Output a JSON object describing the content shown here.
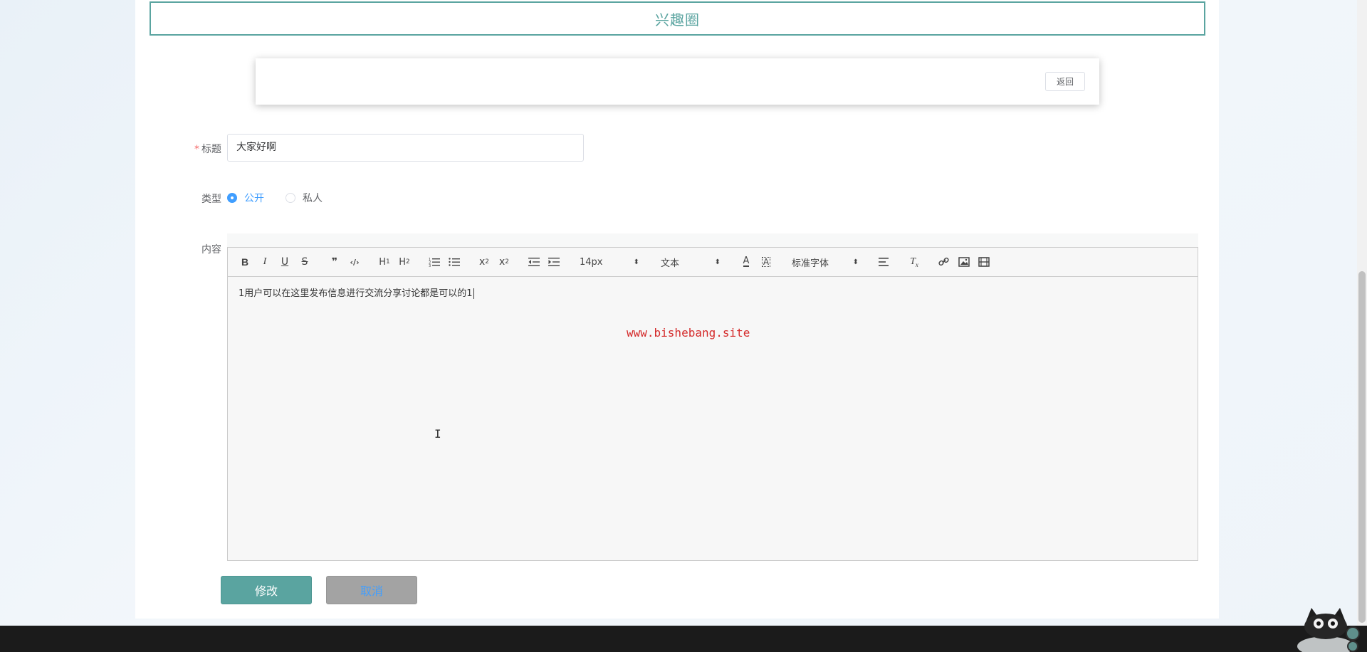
{
  "header": {
    "title": "兴趣圈"
  },
  "toolbar_card": {
    "back_label": "返回"
  },
  "form": {
    "title_label": "标题",
    "title_required_mark": "*",
    "title_value": "大家好啊",
    "type_label": "类型",
    "type_options": [
      {
        "label": "公开",
        "checked": true
      },
      {
        "label": "私人",
        "checked": false
      }
    ],
    "content_label": "内容"
  },
  "editor": {
    "toolbar": {
      "font_size": "14px",
      "header_select": "文本",
      "font_family": "标准字体",
      "icons": [
        "bold-icon",
        "italic-icon",
        "underline-icon",
        "strike-icon",
        "blockquote-icon",
        "code-block-icon",
        "h1-icon",
        "h2-icon",
        "ordered-list-icon",
        "bullet-list-icon",
        "subscript-icon",
        "superscript-icon",
        "outdent-icon",
        "indent-icon",
        "font-color-icon",
        "background-color-icon",
        "align-icon",
        "clean-format-icon",
        "link-icon",
        "image-icon",
        "video-icon"
      ]
    },
    "content": "1用户可以在这里发布信息进行交流分享讨论都是可以的1"
  },
  "watermark": "www.bishebang.site",
  "buttons": {
    "submit": "修改",
    "cancel": "取消"
  },
  "colors": {
    "accent": "#5aa4a0",
    "radio_active": "#409eff",
    "watermark": "#d42a2a"
  }
}
